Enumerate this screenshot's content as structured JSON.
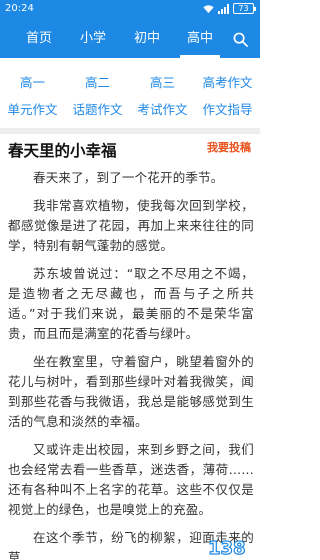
{
  "status": {
    "time": "20:24",
    "battery": "73"
  },
  "nav": {
    "items": [
      "首页",
      "小学",
      "初中",
      "高中"
    ],
    "active": "高中"
  },
  "categories": [
    [
      "高一",
      "高二",
      "高三",
      "高考作文"
    ],
    [
      "单元作文",
      "话题作文",
      "考试作文",
      "作文指导"
    ]
  ],
  "article": {
    "title": "春天里的小幸福",
    "submit_label": "我要投稿",
    "paragraphs": [
      "春天来了，到了一个花开的季节。",
      "我非常喜欢植物，使我每次回到学校，都感觉像是进了花园，再加上来来往往的同学，特别有朝气蓬勃的感觉。",
      "苏东坡曾说过：“取之不尽用之不竭，是造物者之无尽藏也，而吾与子之所共适。”对于我们来说，最美丽的不是荣华富贵，而且而是满室的花香与绿叶。",
      "坐在教室里，守着窗户，眺望着窗外的花儿与树叶，看到那些绿叶对着我微笑，闻到那些花香与我微语，我总是能够感觉到生活的气息和淡然的幸福。",
      "又或许走出校园，来到乡野之间，我们也会经常去看一些香草，迷迭香，薄荷……还有各种叫不上名字的花草。这些不仅仅是视觉上的绿色，也是嗅觉上的充盈。",
      "在这个季节，纷飞的柳絮，迎面走来的草"
    ]
  },
  "watermark": {
    "text": "138"
  },
  "colors": {
    "brand": "#1e88e5",
    "accent": "#e8541f"
  }
}
